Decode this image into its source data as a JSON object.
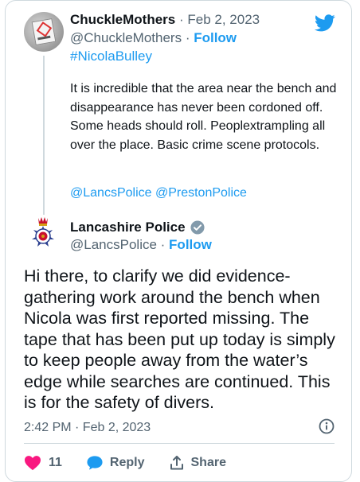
{
  "quoted_tweet": {
    "display_name": "ChuckleMothers",
    "date": "· Feb 2, 2023",
    "handle": "@ChuckleMothers",
    "separator": " · ",
    "follow_label": "Follow",
    "hashtag": "#NicolaBulley",
    "body": "It is incredible that the area near the bench and disappearance has never been cordoned off. Some heads should roll. Peoplextrampling all over the place. Basic crime scene protocols.",
    "mentions": "@LancsPolice @PrestonPolice"
  },
  "reply_tweet": {
    "display_name": "Lancashire Police",
    "handle": "@LancsPolice",
    "separator": " · ",
    "follow_label": "Follow",
    "body": "Hi there, to clarify we did evidence-gathering work around the bench when Nicola was first reported missing. The tape that has been put up today is simply to keep people away from the water’s edge while searches are continued. This is for the safety of divers.",
    "timestamp": "2:42 PM · Feb 2, 2023",
    "likes": "11",
    "reply_label": "Reply",
    "share_label": "Share"
  },
  "icons": {
    "brand": "twitter-bird-icon",
    "verified": "verified-badge-icon",
    "info": "info-icon",
    "like": "heart-icon",
    "reply": "speech-bubble-icon",
    "share": "share-icon"
  },
  "colors": {
    "brand_blue": "#1d9bf0",
    "like_pink": "#f91880",
    "text_primary": "#0f1419",
    "text_secondary": "#536471",
    "border": "#cfd9de"
  }
}
